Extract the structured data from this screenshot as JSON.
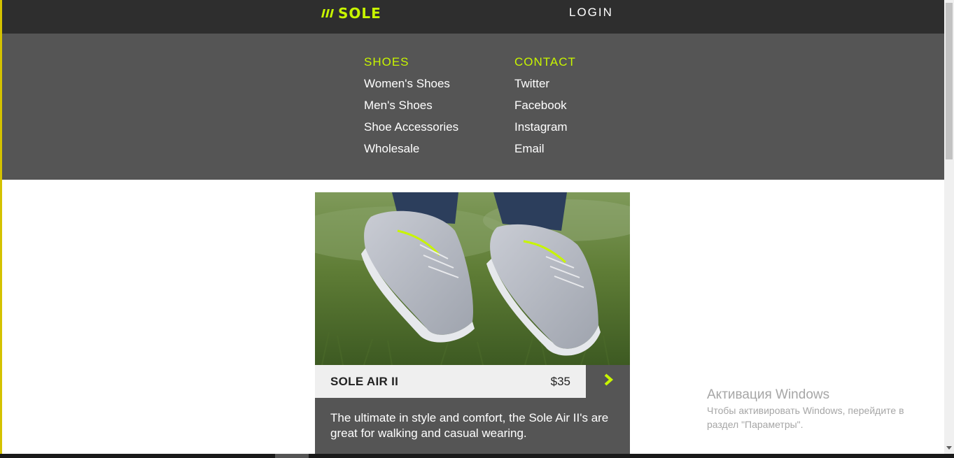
{
  "header": {
    "logo_text": "SOLE",
    "login_label": "LOGIN",
    "accent_color": "#c8f500"
  },
  "menu": {
    "columns": [
      {
        "heading": "SHOES",
        "links": [
          "Women's Shoes",
          "Men's Shoes",
          "Shoe Accessories",
          "Wholesale"
        ]
      },
      {
        "heading": "CONTACT",
        "links": [
          "Twitter",
          "Facebook",
          "Instagram",
          "Email"
        ]
      }
    ]
  },
  "product": {
    "name": "SOLE AIR II",
    "price": "$35",
    "description": "The ultimate in style and comfort, the Sole Air II's are great for walking and casual wearing.",
    "image_alt": "grey sneakers on grass",
    "next_icon": "chevron-right-icon"
  },
  "windows_watermark": {
    "title": "Активация Windows",
    "line1": "Чтобы активировать Windows, перейдите в",
    "line2": "раздел \"Параметры\"."
  }
}
